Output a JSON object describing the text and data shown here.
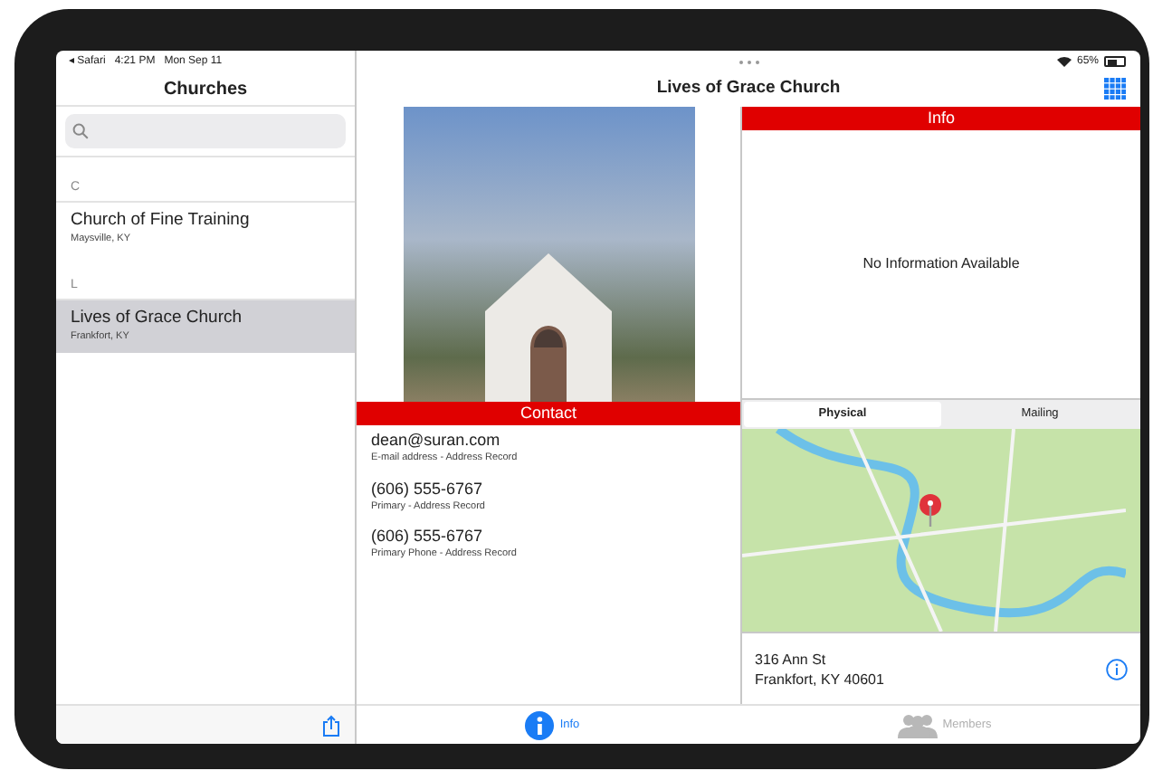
{
  "status_bar": {
    "back": "◂ Safari",
    "time": "4:21 PM",
    "date": "Mon Sep 11",
    "battery": "65%"
  },
  "sidebar": {
    "title": "Churches",
    "sections": [
      {
        "letter": "C",
        "items": [
          {
            "name": "Church of Fine Training",
            "location": "Maysville, KY",
            "selected": false
          }
        ]
      },
      {
        "letter": "L",
        "items": [
          {
            "name": "Lives of Grace Church",
            "location": "Frankfort, KY",
            "selected": true
          }
        ]
      }
    ]
  },
  "detail": {
    "title": "Lives of Grace Church",
    "info": {
      "header": "Info",
      "text": "No Information Available"
    },
    "contact": {
      "header": "Contact",
      "entries": [
        {
          "value": "dean@suran.com",
          "label": "E-mail address - Address Record"
        },
        {
          "value": "(606) 555-6767",
          "label": "Primary - Address Record"
        },
        {
          "value": "(606) 555-6767",
          "label": "Primary Phone - Address Record"
        }
      ]
    },
    "address": {
      "tabs": [
        {
          "label": "Physical",
          "selected": true
        },
        {
          "label": "Mailing",
          "selected": false
        }
      ],
      "lines": [
        "316 Ann St",
        "Frankfort, KY 40601"
      ]
    }
  },
  "tab_bar": [
    {
      "label": "Info",
      "kind": "info",
      "selected": true
    },
    {
      "label": "Members",
      "kind": "members",
      "selected": false
    }
  ]
}
